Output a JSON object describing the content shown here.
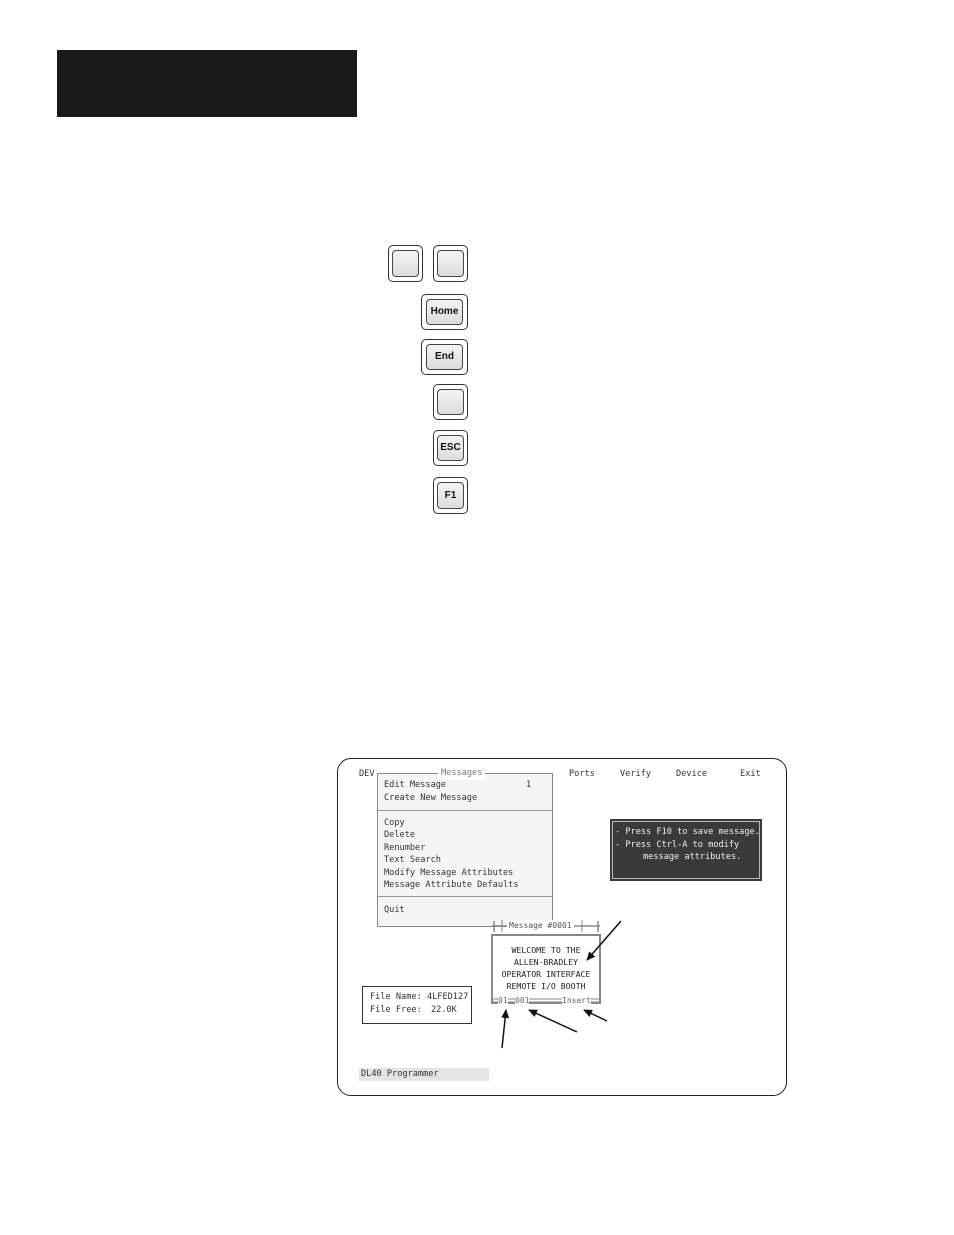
{
  "keys": {
    "home_label": "Home",
    "end_label": "End",
    "esc_label": "ESC",
    "f1_label": "F1"
  },
  "screen": {
    "menubar": {
      "dev": "DEV",
      "ports": "Ports",
      "verify": "Verify",
      "device": "Device",
      "exit": "Exit"
    },
    "messages_menu": {
      "title": "Messages",
      "edit_message": "Edit Message",
      "edit_message_value": "1",
      "create_new_message": "Create New Message",
      "copy": "Copy",
      "delete": "Delete",
      "renumber": "Renumber",
      "text_search": "Text Search",
      "modify_attributes": "Modify Message Attributes",
      "attribute_defaults": "Message Attribute Defaults",
      "quit": "Quit"
    },
    "hint": {
      "line1": "- Press F10 to save message.",
      "line2": "- Press Ctrl-A to modify",
      "line3": "message attributes."
    },
    "message_window": {
      "title": "Message #0001",
      "line1": "WELCOME TO THE",
      "line2": "ALLEN-BRADLEY",
      "line3": "OPERATOR INTERFACE",
      "line4": "REMOTE I/O BOOTH",
      "status_line": "01",
      "status_col": "001",
      "status_mode": "Insert"
    },
    "file_info": {
      "name_label": "File Name:",
      "name_value": "4LFED127",
      "free_label": "File Free:",
      "free_value": "22.0K"
    },
    "status_bar": "DL40 Programmer"
  }
}
